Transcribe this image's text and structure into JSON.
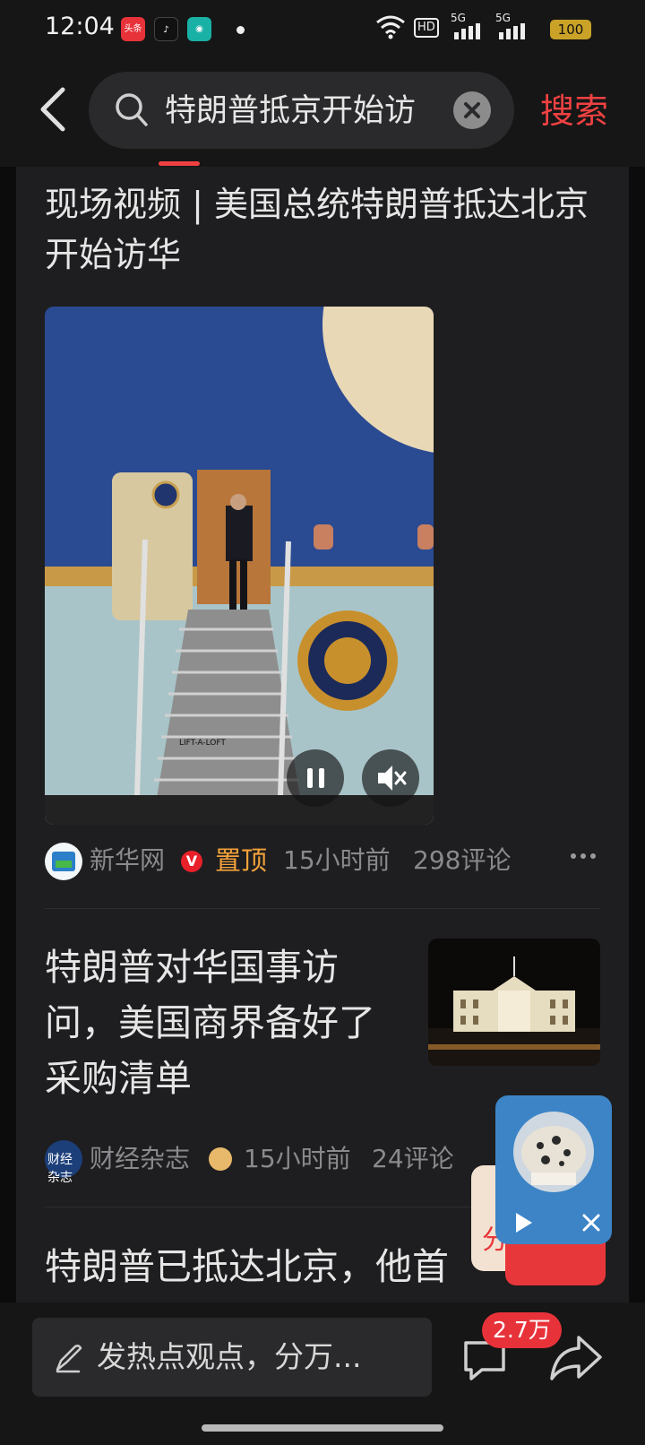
{
  "status_bar": {
    "time": "12:04",
    "apps": [
      "头条",
      "抖音",
      "消息"
    ],
    "network": "HD",
    "signal_1": "5G",
    "signal_2": "5G",
    "battery": "100"
  },
  "header": {
    "search_query": "特朗普抵京开始访",
    "search_button": "搜索",
    "icons": [
      "back-arrow-icon",
      "search-icon",
      "clear-icon"
    ]
  },
  "articles": [
    {
      "title": "现场视频 | 美国总统特朗普抵达北京开始访华",
      "source": "新华网",
      "verified": "V",
      "pinned": "置顶",
      "time": "15小时前",
      "comments": "298评论",
      "video_text": "LIFT-A-LOFT",
      "controls": [
        "pause-icon",
        "mute-icon"
      ]
    },
    {
      "title": "特朗普对华国事访问，美国商界备好了采购清单",
      "source": "财经杂志",
      "time": "15小时前",
      "comments": "24评论"
    },
    {
      "title": "特朗普已抵达北京，他首"
    }
  ],
  "floating": {
    "promo_text": "分红",
    "controls": [
      "play-icon",
      "close-icon"
    ]
  },
  "bottom_bar": {
    "comment_placeholder": "发热点观点，分万...",
    "comment_count": "2.7万",
    "icons": [
      "pen-icon",
      "comment-icon",
      "share-icon"
    ]
  },
  "colors": {
    "accent": "#f04142",
    "pinned": "#f2a23a",
    "background": "#1e1e20",
    "float_player": "#3c84c6"
  }
}
